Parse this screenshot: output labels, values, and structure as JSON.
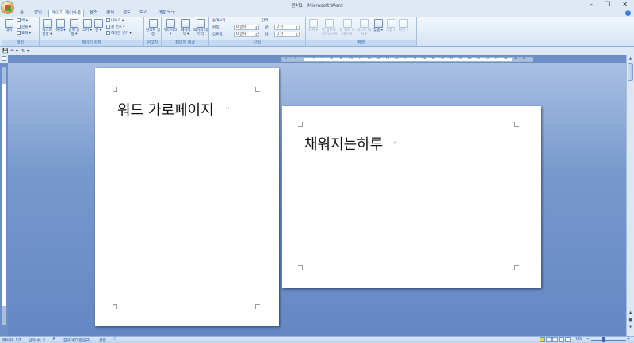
{
  "window": {
    "title": "문서1 - Microsoft Word",
    "minimize": "–",
    "maximize": "❐",
    "close": "✕"
  },
  "tabs": [
    {
      "label": "홈"
    },
    {
      "label": "삽입"
    },
    {
      "label": "페이지 레이아웃"
    },
    {
      "label": "참조"
    },
    {
      "label": "편지"
    },
    {
      "label": "검토"
    },
    {
      "label": "보기"
    },
    {
      "label": "개발 도구"
    }
  ],
  "help": "?",
  "ribbon": {
    "theme": {
      "label": "테마",
      "big": "테마",
      "small": [
        "색 ▾",
        "글꼴 ▾",
        "효과 ▾"
      ]
    },
    "page_setup": {
      "label": "페이지 설정",
      "buttons": [
        "텍스트 방향 ▾",
        "여백 ▾",
        "용지 방향 ▾",
        "크기 ▾",
        "단 ▾"
      ],
      "small": [
        "나누기 ▾",
        "줄 번호 ▾",
        "하이픈 넣기 ▾"
      ]
    },
    "background_draft": {
      "label": "원고지",
      "big": "원고지 설정"
    },
    "page_background": {
      "label": "페이지 배경",
      "buttons": [
        "워터마크 ▾",
        "페이지 색 ▾",
        "페이지 테두리"
      ]
    },
    "paragraph": {
      "label": "단락",
      "indent_header": "들여쓰기",
      "spacing_header": "간격",
      "indent_left_label": "왼쪽:",
      "indent_left": "0 글자",
      "indent_right_label": "오른쪽:",
      "indent_right": "0 글자",
      "spacing_before_label": "앞:",
      "spacing_before": "0 선",
      "spacing_after_label": "뒤:",
      "spacing_after": "0 선"
    },
    "arrange": {
      "label": "정렬",
      "buttons": [
        "위치 ▾",
        "맨 앞으로 가져오기 ▾",
        "맨 뒤로 보내기 ▾",
        "텍스트 배치 ▾",
        "맞춤 ▾",
        "그룹 ▾",
        "회전 ▾"
      ]
    }
  },
  "qat": {
    "save": "💾",
    "undo": "↶ ▾",
    "redo": "↻",
    "more": "▾"
  },
  "ruler": {
    "numbers": [
      "4",
      "2",
      "",
      "2",
      "4",
      "6",
      "8",
      "10",
      "12",
      "14",
      "16",
      "18",
      "20",
      "22",
      "24",
      "26",
      "28",
      "30",
      "32",
      "34",
      "36",
      "38",
      "40",
      "42",
      "44",
      "46",
      "48"
    ]
  },
  "pages": {
    "page1": {
      "text": "워드 가로페이지",
      "mark": "↵"
    },
    "page2": {
      "text": "채워지는하루",
      "mark": "↵"
    }
  },
  "statusbar": {
    "page": "페이지: 1/1",
    "words": "단어 수: 3",
    "language": "한국어(대한민국)",
    "mode": "삽입",
    "zoom": "70%",
    "zoom_minus": "−",
    "zoom_plus": "+"
  },
  "colors": {
    "accent": "#15428b",
    "workspace": "#6b8fc6",
    "ribbon_border": "#8db2e3"
  }
}
